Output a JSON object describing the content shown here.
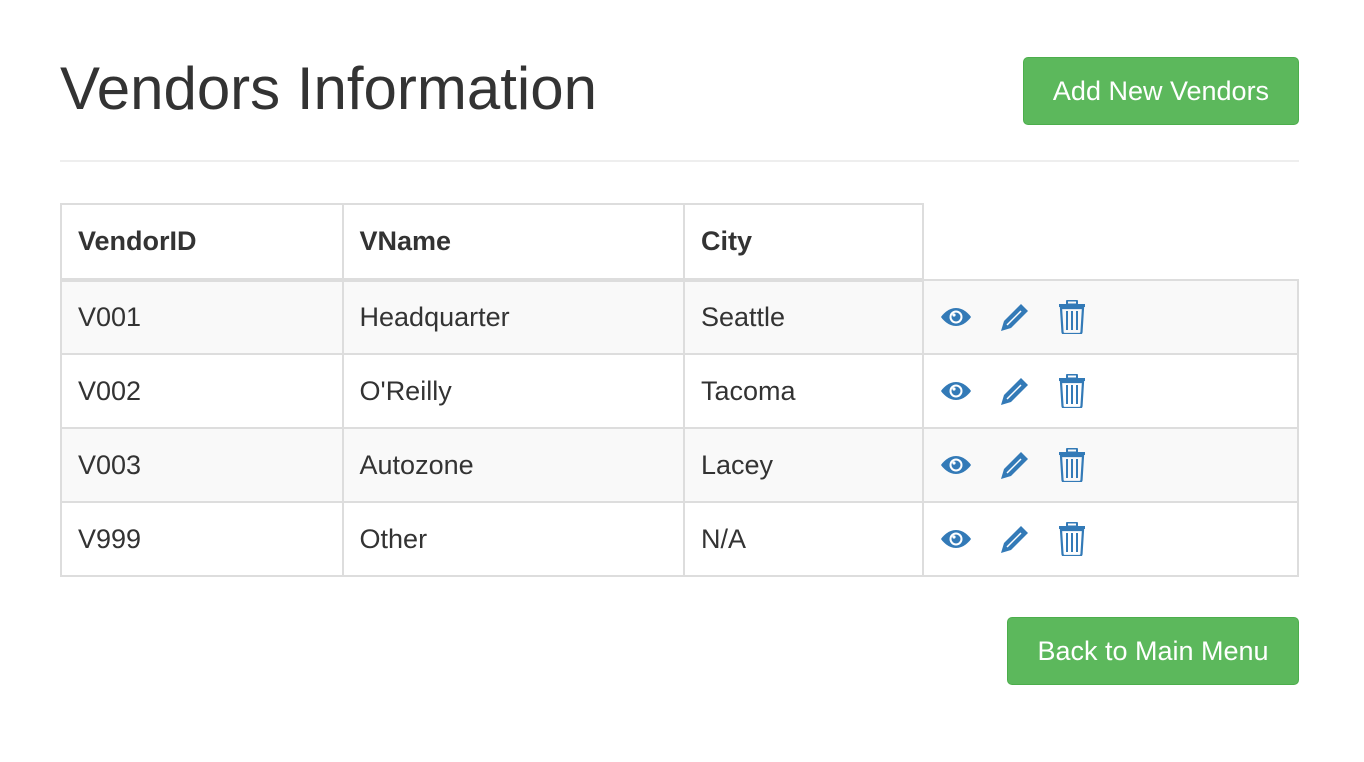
{
  "header": {
    "title": "Vendors Information",
    "add_label": "Add New Vendors"
  },
  "table": {
    "columns": [
      "VendorID",
      "VName",
      "City"
    ],
    "rows": [
      {
        "id": "V001",
        "name": "Headquarter",
        "city": "Seattle"
      },
      {
        "id": "V002",
        "name": "O'Reilly",
        "city": "Tacoma"
      },
      {
        "id": "V003",
        "name": "Autozone",
        "city": "Lacey"
      },
      {
        "id": "V999",
        "name": "Other",
        "city": "N/A"
      }
    ],
    "row_actions": [
      "eye-icon",
      "pencil-icon",
      "trash-icon"
    ]
  },
  "footer": {
    "back_label": "Back to Main Menu"
  },
  "colors": {
    "success": "#5cb85c",
    "icon": "#337ab7",
    "text": "#333333",
    "border": "#dddddd",
    "stripe": "#f9f9f9"
  }
}
